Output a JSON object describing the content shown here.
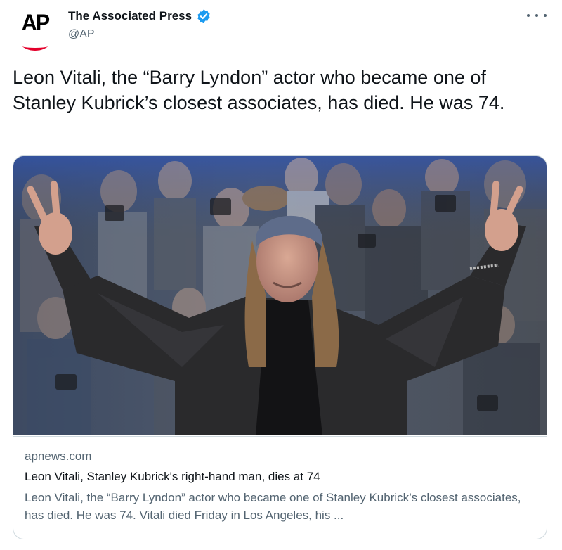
{
  "author": {
    "display_name": "The Associated Press",
    "handle": "@AP",
    "avatar_text": "AP",
    "verified": true
  },
  "tweet": {
    "text": "Leon Vitali, the “Barry Lyndon” actor who became one of Stanley Kubrick’s closest associates, has died. He was 74."
  },
  "card": {
    "domain": "apnews.com",
    "title": "Leon Vitali, Stanley Kubrick's right-hand man, dies at 74",
    "description": "Leon Vitali, the “Barry Lyndon” actor who became one of Stanley Kubrick’s closest associates, has died. He was 74. Vitali died Friday in Los Angeles, his ..."
  },
  "colors": {
    "verified_blue": "#1d9bf0",
    "ap_red": "#e4002b",
    "secondary_text": "#536471",
    "border": "#cfd9de"
  },
  "icons": {
    "verified": "verified-badge-icon",
    "more": "more-options-icon"
  }
}
